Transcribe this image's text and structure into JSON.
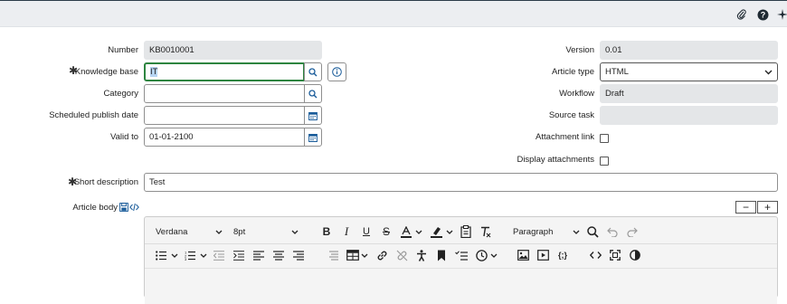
{
  "header": {
    "icons": [
      "paperclip-icon",
      "help-icon",
      "sparkle-icon"
    ]
  },
  "form": {
    "number": {
      "label": "Number",
      "value": "KB0010001"
    },
    "knowledge_base": {
      "label": "Knowledge base",
      "value": "IT",
      "required": true
    },
    "category": {
      "label": "Category",
      "value": ""
    },
    "scheduled_publish_date": {
      "label": "Scheduled publish date",
      "value": ""
    },
    "valid_to": {
      "label": "Valid to",
      "value": "01-01-2100"
    },
    "version": {
      "label": "Version",
      "value": "0.01"
    },
    "article_type": {
      "label": "Article type",
      "value": "HTML"
    },
    "workflow": {
      "label": "Workflow",
      "value": "Draft"
    },
    "source_task": {
      "label": "Source task",
      "value": ""
    },
    "attachment_link": {
      "label": "Attachment link",
      "checked": false
    },
    "display_attachments": {
      "label": "Display attachments",
      "checked": false
    },
    "short_description": {
      "label": "Short description",
      "value": "Test",
      "required": true
    },
    "article_body": {
      "label": "Article body"
    }
  },
  "editor": {
    "font_family": "Verdana",
    "font_size": "8pt",
    "block_format": "Paragraph",
    "toolbar_row1": [
      "bold",
      "italic",
      "underline",
      "strikethrough",
      "text-color",
      "highlight-color",
      "paste-as-text",
      "clear-formatting",
      "search",
      "undo",
      "redo"
    ],
    "toolbar_row2": [
      "bullet-list",
      "numbered-list",
      "outdent",
      "indent",
      "align-left",
      "align-center",
      "align-right",
      "align-justify",
      "table",
      "link",
      "unlink",
      "accessibility",
      "bookmark",
      "checklist",
      "clock",
      "image",
      "media",
      "template",
      "source-code",
      "fullscreen",
      "contrast"
    ]
  }
}
